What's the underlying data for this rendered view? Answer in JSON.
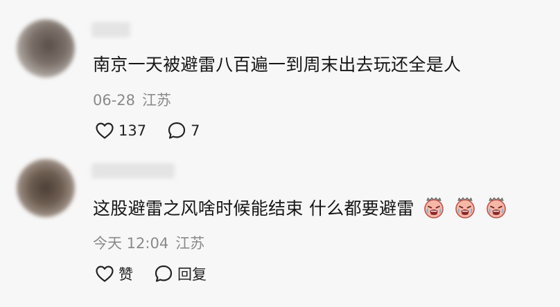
{
  "comments": [
    {
      "text": "南京一天被避雷八百遍一到周末出去玩还全是人",
      "date": "06-28",
      "location": "江苏",
      "like_count": "137",
      "reply_count": "7"
    },
    {
      "text": "这股避雷之风啥时候能结束 什么都要避雷",
      "emoji": [
        "crying-face-emoji",
        "crying-face-emoji",
        "crying-face-emoji"
      ],
      "date": "今天 12:04",
      "location": "江苏",
      "like_label": "赞",
      "reply_label": "回复"
    }
  ],
  "icons": {
    "like": "heart-outline-icon",
    "reply": "speech-bubble-outline-icon"
  },
  "colors": {
    "background": "#f7f7f7",
    "text": "#161616",
    "meta": "#8a8a8a"
  }
}
